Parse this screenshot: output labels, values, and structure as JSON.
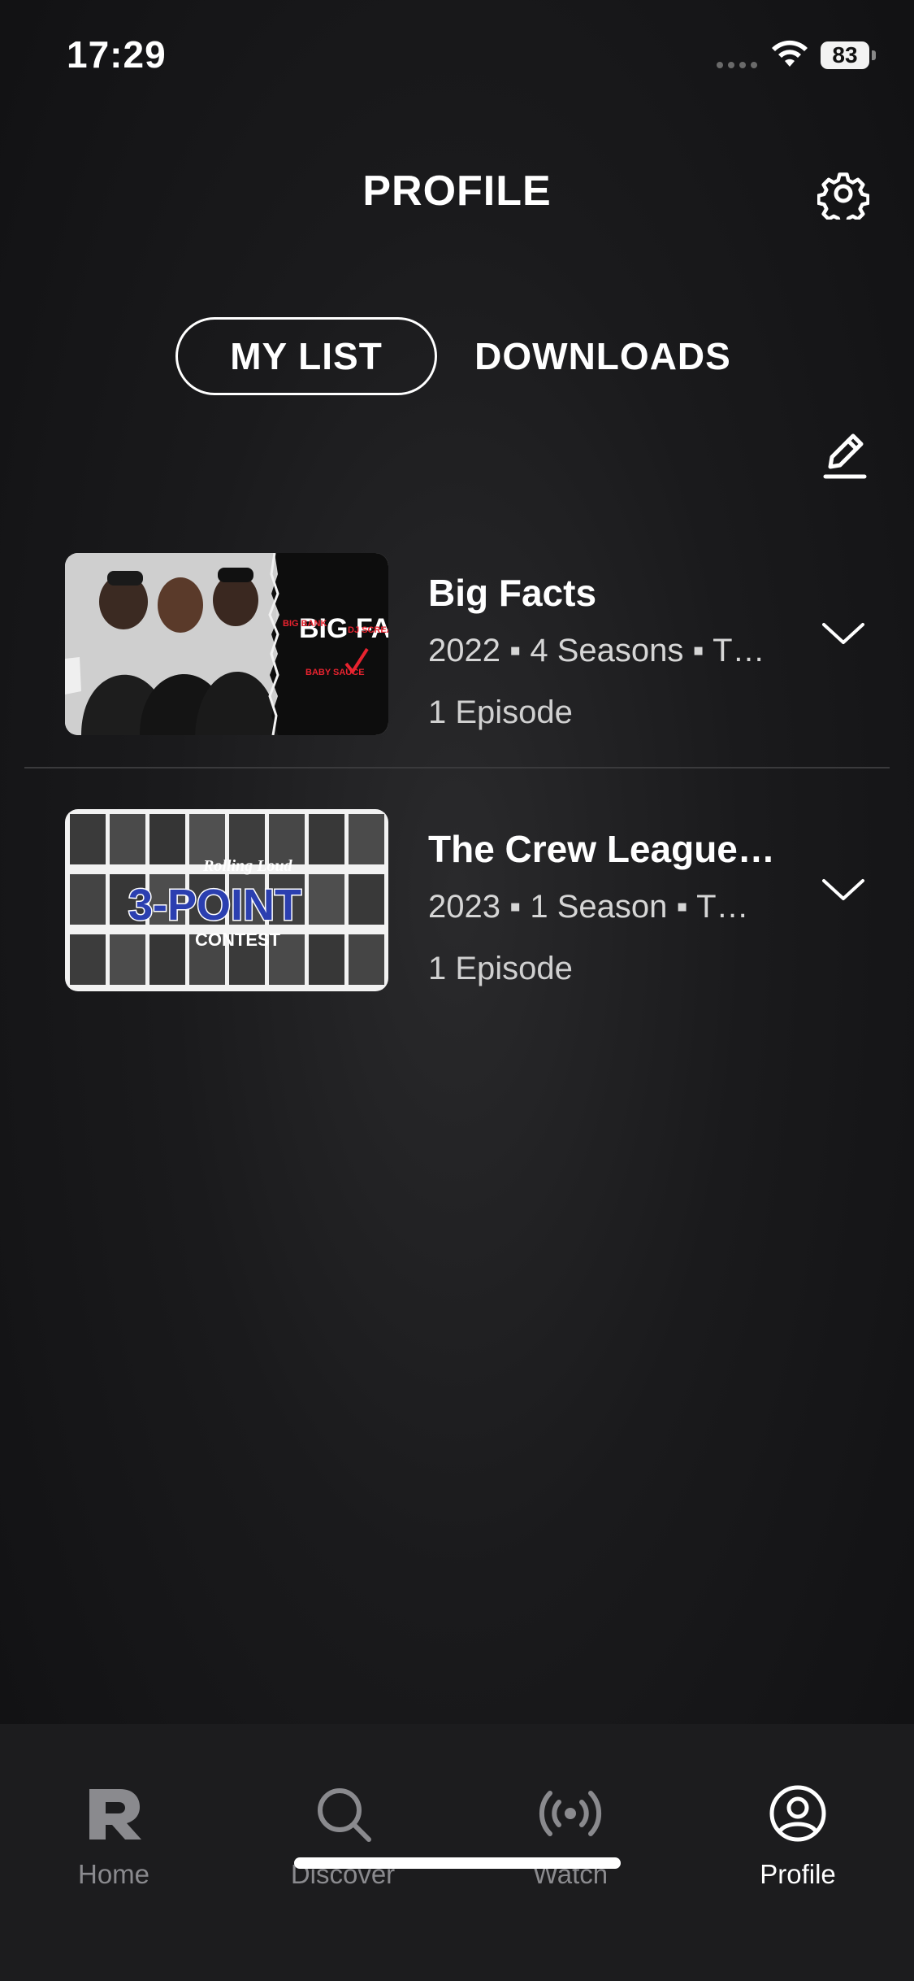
{
  "status_bar": {
    "time": "17:29",
    "battery": "83"
  },
  "header": {
    "title": "PROFILE"
  },
  "tabs": [
    {
      "label": "MY LIST",
      "active": true
    },
    {
      "label": "DOWNLOADS",
      "active": false
    }
  ],
  "list": [
    {
      "title": "Big Facts",
      "meta": "2022 ▪ 4 Seasons ▪ T…",
      "episodes": "1 Episode",
      "thumb": {
        "caption": "BIG FACTS",
        "small": "BIG BANK",
        "dj": "DJ SCREAM",
        "badge": "BABY SAUCE"
      }
    },
    {
      "title": "The Crew League:…",
      "meta": "2023 ▪ 1 Season ▪ T…",
      "episodes": "1 Episode",
      "thumb": {
        "caption": "3-POINT",
        "contest": "CONTEST",
        "logo": "Rolling Loud"
      }
    }
  ],
  "bottom_nav": [
    {
      "label": "Home",
      "active": false,
      "icon": "r-logo-icon"
    },
    {
      "label": "Discover",
      "active": false,
      "icon": "search-icon"
    },
    {
      "label": "Watch",
      "active": false,
      "icon": "broadcast-icon"
    },
    {
      "label": "Profile",
      "active": true,
      "icon": "user-circle-icon"
    }
  ],
  "colors": {
    "background": "#141416",
    "nav_bg": "#1c1c1e",
    "inactive": "#8a8a8e",
    "accent_red": "#e8232f",
    "thumb_blue": "#2b3fb0"
  }
}
